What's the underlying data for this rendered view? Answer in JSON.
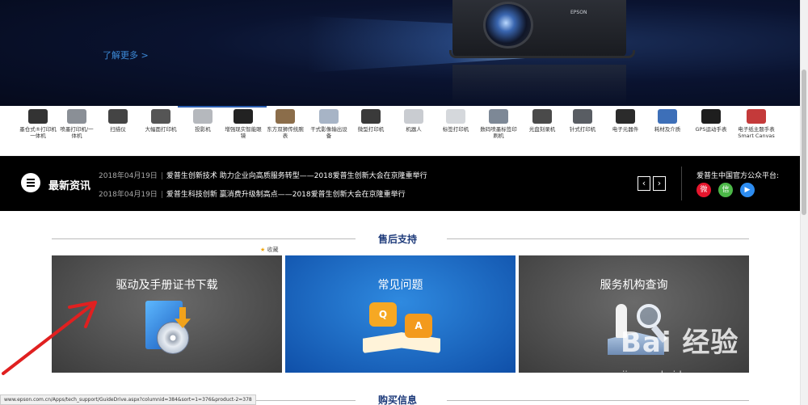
{
  "hero": {
    "learn_more": "了解更多 >",
    "brand": "EPSON"
  },
  "product_nav": {
    "items": [
      {
        "label": "墨仓式®打印机一体机",
        "color": "#333333"
      },
      {
        "label": "喷墨打印机/一体机",
        "color": "#8a8f96"
      },
      {
        "label": "扫描仪",
        "color": "#444444"
      },
      {
        "label": "大幅面打印机",
        "color": "#555555"
      },
      {
        "label": "投影机",
        "color": "#b5b8bd"
      },
      {
        "label": "增强现实智能眼镜",
        "color": "#222222"
      },
      {
        "label": "东方双狮传统腕表",
        "color": "#8b6d4a"
      },
      {
        "label": "干式影像输出设备",
        "color": "#a7b4c6"
      },
      {
        "label": "微型打印机",
        "color": "#3a3a3a"
      },
      {
        "label": "机器人",
        "color": "#c9ccd1"
      },
      {
        "label": "标签打印机",
        "color": "#d5d8dc"
      },
      {
        "label": "数码喷墨标签印刷机",
        "color": "#7d8896"
      },
      {
        "label": "光盘刻录机",
        "color": "#4a4a4a"
      },
      {
        "label": "针式打印机",
        "color": "#595d63"
      },
      {
        "label": "电子元器件",
        "color": "#2b2b2b"
      },
      {
        "label": "耗材及介质",
        "color": "#3d6fb8"
      },
      {
        "label": "GPS运动手表",
        "color": "#1e1e1e"
      },
      {
        "label": "电子纸主题手表Smart Canvas",
        "color": "#c43a3a"
      }
    ]
  },
  "news": {
    "title": "最新资讯",
    "items": [
      {
        "date": "2018年04月19日",
        "sep": "|",
        "text": "爱普生创新技术 助力企业向高质服务转型——2018爱普生创新大会在京隆重举行"
      },
      {
        "date": "2018年04月19日",
        "sep": "|",
        "text": "爱普生科技创新 赢消费升级制高点——2018爱普生创新大会在京隆重举行"
      }
    ],
    "prev": "‹",
    "next": "›",
    "social_title": "爱普生中国官方公众平台:",
    "social": [
      {
        "name": "weibo",
        "glyph": "微",
        "color": "#e6162d"
      },
      {
        "name": "wechat",
        "glyph": "信",
        "color": "#4cb848"
      },
      {
        "name": "video",
        "glyph": "▶",
        "color": "#2d8cf0"
      }
    ]
  },
  "support": {
    "section_title": "售后支持",
    "favorite": "收藏",
    "cards": [
      {
        "title": "驱动及手册证书下载"
      },
      {
        "title": "常见问题",
        "q": "Q",
        "a": "A"
      },
      {
        "title": "服务机构查询"
      }
    ]
  },
  "purchase": {
    "section_title": "购买信息"
  },
  "watermark": {
    "main": "Bai 经验",
    "sub": "jingyan.baidu.com"
  },
  "status_url": "www.epson.com.cn/Apps/tech_support/GuideDrive.aspx?columnid=384&sort=1=376&product-2=378"
}
